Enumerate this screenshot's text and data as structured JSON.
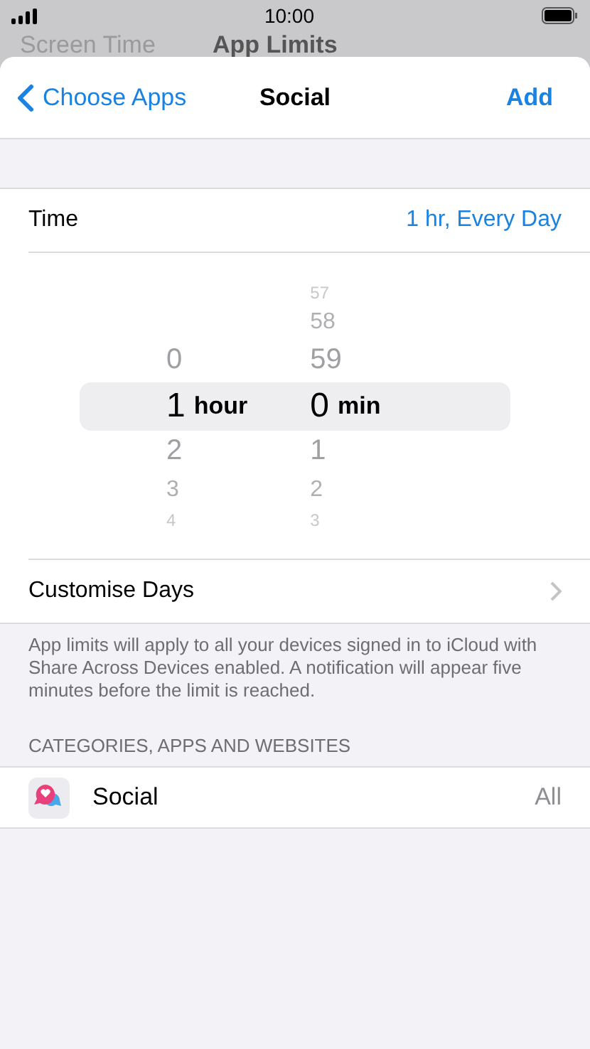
{
  "status_bar": {
    "time": "10:00"
  },
  "background_nav": {
    "back": "Screen Time",
    "title": "App Limits"
  },
  "nav": {
    "back": "Choose Apps",
    "title": "Social",
    "action": "Add"
  },
  "time_row": {
    "label": "Time",
    "value": "1 hr, Every Day"
  },
  "picker": {
    "columns": [
      {
        "unit": "hour",
        "items": [
          {
            "text": "0",
            "selected": false
          },
          {
            "text": "1",
            "selected": true
          },
          {
            "text": "2",
            "selected": false
          },
          {
            "text": "3",
            "selected": false
          },
          {
            "text": "4",
            "selected": false
          }
        ]
      },
      {
        "unit": "min",
        "items": [
          {
            "text": "57",
            "selected": false
          },
          {
            "text": "58",
            "selected": false
          },
          {
            "text": "59",
            "selected": false
          },
          {
            "text": "0",
            "selected": true
          },
          {
            "text": "1",
            "selected": false
          },
          {
            "text": "2",
            "selected": false
          },
          {
            "text": "3",
            "selected": false
          }
        ]
      }
    ]
  },
  "customise_row": {
    "label": "Customise Days"
  },
  "footer": "App limits will apply to all your devices signed in to iCloud with Share Across Devices enabled. A notification will appear five minutes before the limit is reached.",
  "section_header": "CATEGORIES, APPS AND WEBSITES",
  "apps": [
    {
      "name": "Social",
      "value": "All"
    }
  ]
}
